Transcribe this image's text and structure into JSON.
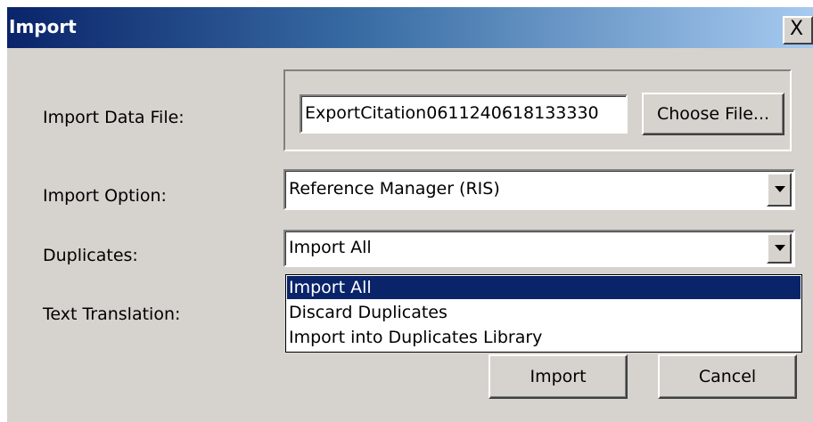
{
  "window": {
    "title": "Import",
    "close_glyph": "X"
  },
  "form": {
    "import_data_file": {
      "label": "Import Data File:",
      "value": "ExportCitation0611240618133330",
      "choose_button": "Choose File..."
    },
    "import_option": {
      "label": "Import Option:",
      "value": "Reference Manager (RIS)"
    },
    "duplicates": {
      "label": "Duplicates:",
      "value": "Import All",
      "options": [
        "Import All",
        "Discard Duplicates",
        "Import into Duplicates Library"
      ],
      "selected_index": 0,
      "expanded": true
    },
    "text_translation": {
      "label": "Text Translation:"
    }
  },
  "buttons": {
    "import": "Import",
    "cancel": "Cancel"
  },
  "colors": {
    "dialog_face": "#d6d3ce",
    "title_start": "#0a246a",
    "title_end": "#a6caf0",
    "selection": "#0a246a"
  },
  "icons": {
    "dropdown_arrow": "triangle-down-icon",
    "close": "close-icon"
  }
}
